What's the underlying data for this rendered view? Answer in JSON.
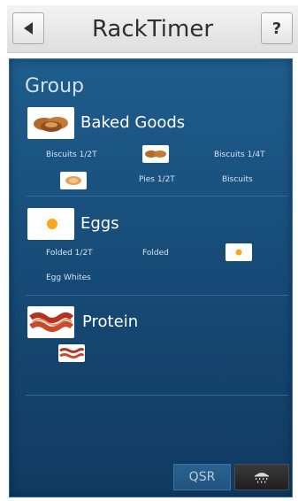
{
  "header": {
    "title": "RackTimer",
    "help_label": "?"
  },
  "panel": {
    "heading": "Group",
    "categories": [
      {
        "name": "Baked Goods",
        "icon": "biscuits-icon",
        "items": [
          "Biscuits 1/2T",
          "Biscuits 1/4T",
          "Pies 1/2T",
          "Biscuits"
        ]
      },
      {
        "name": "Eggs",
        "icon": "fried-egg-icon",
        "items": [
          "Folded 1/2T",
          "Folded",
          "Egg Whites"
        ]
      },
      {
        "name": "Protein",
        "icon": "bacon-icon",
        "items": []
      }
    ]
  },
  "footer": {
    "qsr_label": "QSR",
    "shower_icon": "shower-icon"
  },
  "colors": {
    "panel": "#174c78",
    "header": "#e8e8e8",
    "text_light": "#d6e3ef"
  }
}
